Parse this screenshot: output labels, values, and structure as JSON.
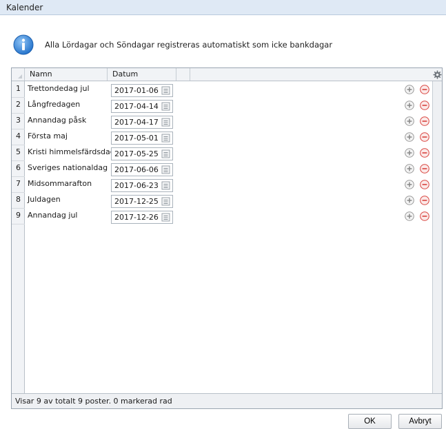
{
  "window": {
    "title": "Kalender"
  },
  "info": {
    "icon": "info-icon",
    "message": "Alla Lördagar och Söndagar registreras automatiskt som icke bankdagar"
  },
  "grid": {
    "columns": {
      "name": "Namn",
      "date": "Datum"
    },
    "rows": [
      {
        "num": "1",
        "name": "Trettondedag jul",
        "date": "2017-01-06"
      },
      {
        "num": "2",
        "name": "Långfredagen",
        "date": "2017-04-14"
      },
      {
        "num": "3",
        "name": "Annandag påsk",
        "date": "2017-04-17"
      },
      {
        "num": "4",
        "name": "Första maj",
        "date": "2017-05-01"
      },
      {
        "num": "5",
        "name": "Kristi himmelsfärdsdag",
        "date": "2017-05-25"
      },
      {
        "num": "6",
        "name": "Sveriges nationaldag",
        "date": "2017-06-06"
      },
      {
        "num": "7",
        "name": "Midsommarafton",
        "date": "2017-06-23"
      },
      {
        "num": "8",
        "name": "Juldagen",
        "date": "2017-12-25"
      },
      {
        "num": "9",
        "name": "Annandag jul",
        "date": "2017-12-26"
      }
    ],
    "status": "Visar 9 av totalt 9 poster. 0 markerad rad"
  },
  "buttons": {
    "ok": "OK",
    "cancel": "Avbryt"
  },
  "colors": {
    "plus": "#9a9a9a",
    "minus": "#d9443f",
    "info": "#2b7fd6",
    "titlebar": "#dfe9f5"
  }
}
